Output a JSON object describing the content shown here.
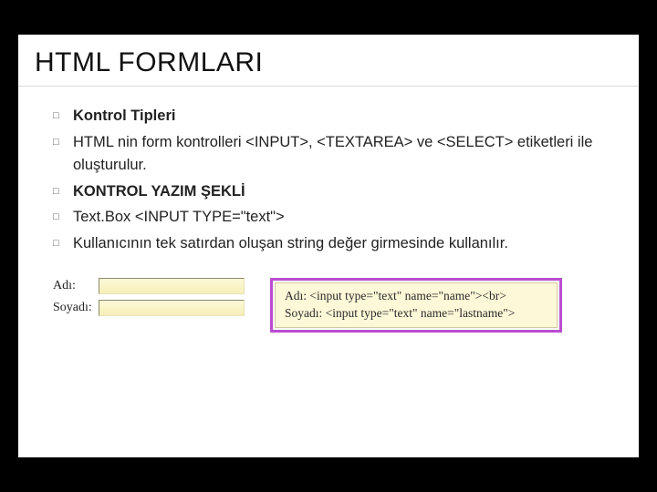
{
  "title": "HTML FORMLARI",
  "bullets": {
    "b1": "Kontrol Tipleri",
    "b2": "HTML nin form kontrolleri <INPUT>, <TEXTAREA> ve <SELECT> etiketleri ile oluşturulur.",
    "b3": "KONTROL YAZIM ŞEKLİ",
    "b4": "Text.Box <INPUT TYPE=\"text\">",
    "b5": "Kullanıcının tek satırdan oluşan string değer girmesinde kullanılır."
  },
  "form": {
    "label1": "Adı:",
    "label2": "Soyadı:"
  },
  "code": {
    "line1": "Adı: <input type=\"text\" name=\"name\"><br>",
    "line2": "Soyadı: <input type=\"text\" name=\"lastname\">"
  }
}
